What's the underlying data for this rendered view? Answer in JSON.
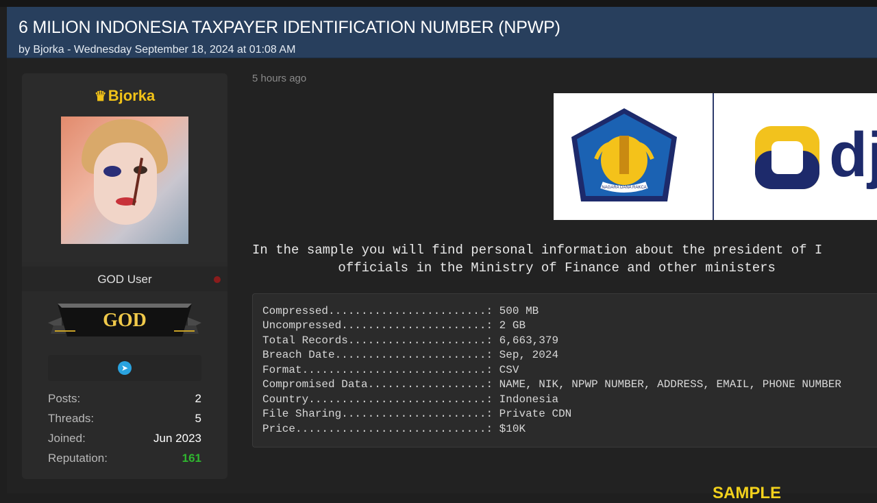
{
  "thread": {
    "title": "6 MILION INDONESIA TAXPAYER IDENTIFICATION NUMBER (NPWP)",
    "byline": "by Bjorka - Wednesday September 18, 2024 at 01:08 AM"
  },
  "author": {
    "username": "Bjorka",
    "crown_glyph": "♛",
    "rank": "GOD User",
    "badge_text": "GOD",
    "stats": [
      {
        "key": "Posts:",
        "value": "2"
      },
      {
        "key": "Threads:",
        "value": "5"
      },
      {
        "key": "Joined:",
        "value": "Jun 2023"
      },
      {
        "key": "Reputation:",
        "value": "161"
      }
    ],
    "colors": {
      "username": "#f2c318",
      "reputation": "#2fb62f",
      "status_dot": "#8a1c1c"
    }
  },
  "post": {
    "timestamp": "5 hours ago",
    "banner_text": "dj",
    "banner_seal_text": "NAGARA DANA RAKCA",
    "intro_line1": "In the sample you will find personal information about the president of I",
    "intro_line2": "           officials in the Ministry of Finance and other ministers",
    "details": [
      "Compressed........................: 500 MB",
      "Uncompressed......................: 2 GB",
      "Total Records.....................: 6,663,379",
      "Breach Date.......................: Sep, 2024",
      "Format............................: CSV",
      "Compromised Data..................: NAME, NIK, NPWP NUMBER, ADDRESS, EMAIL, PHONE NUMBER",
      "Country...........................: Indonesia",
      "File Sharing......................: Private CDN",
      "Price.............................: $10K"
    ],
    "sample_heading": "SAMPLE"
  }
}
